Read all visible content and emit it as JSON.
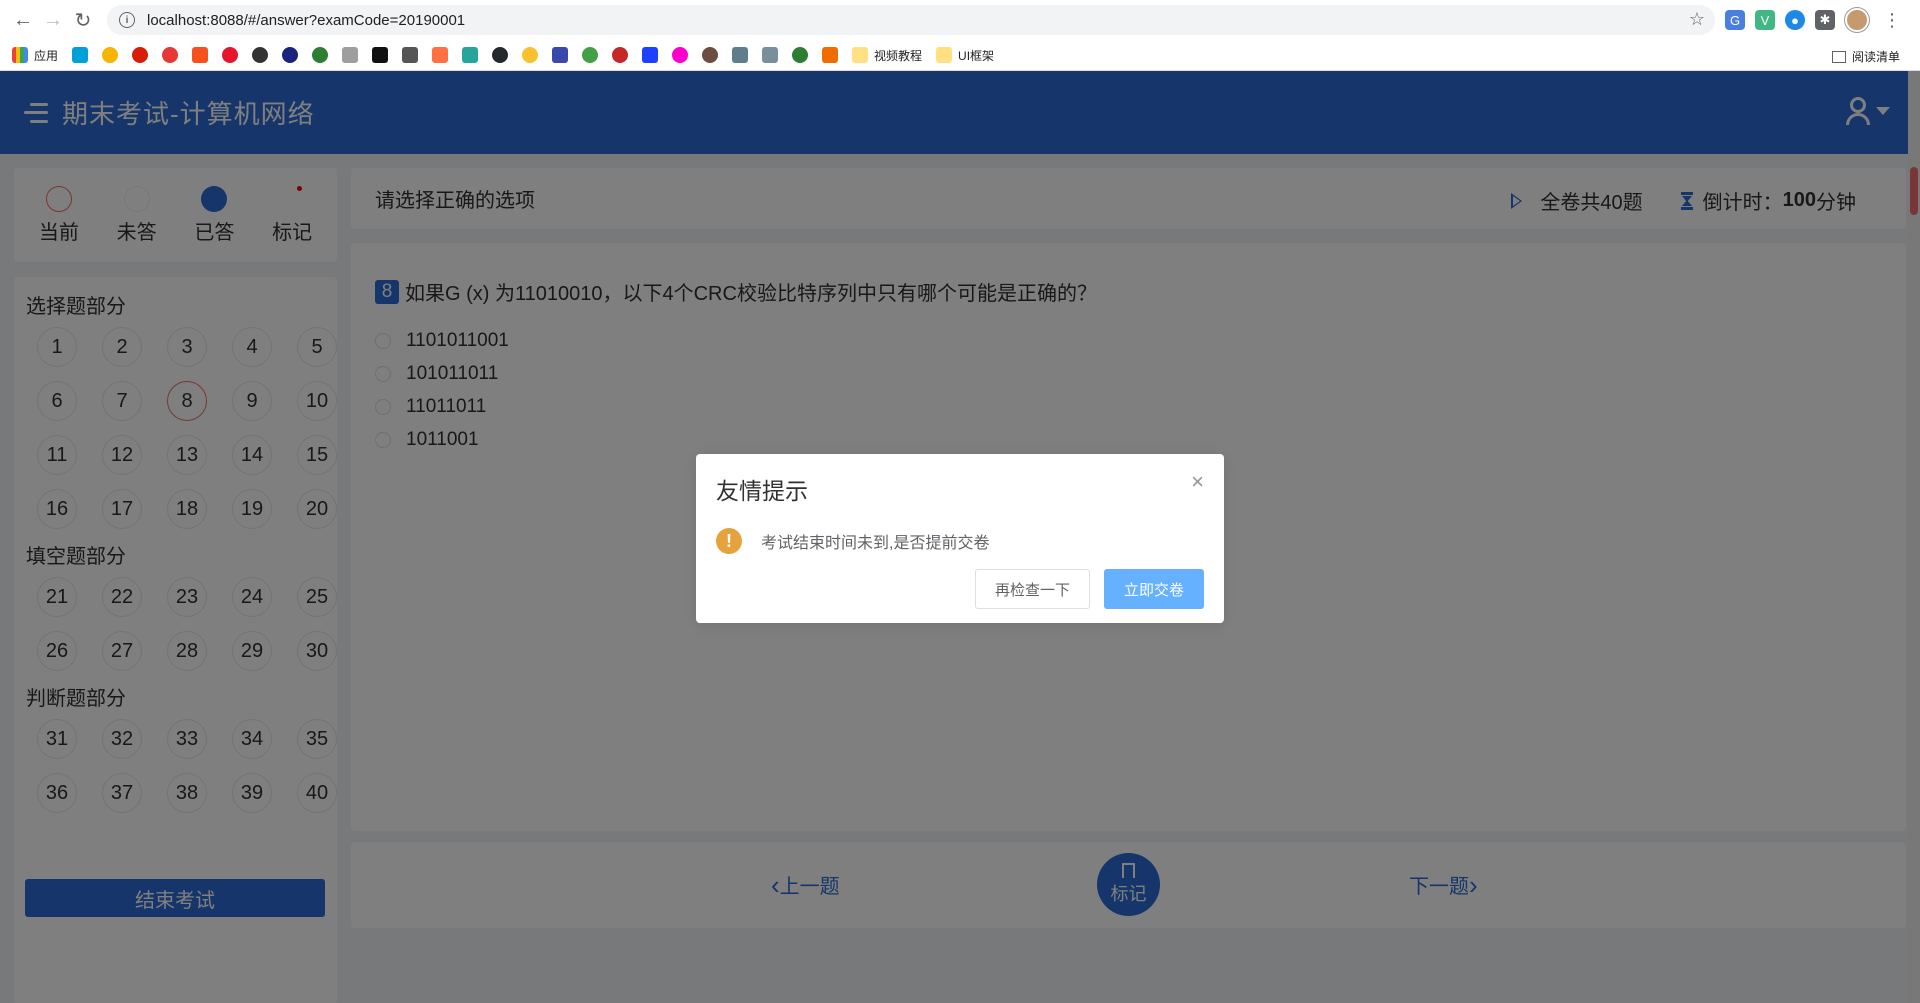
{
  "browser": {
    "url": "localhost:8088/#/answer?examCode=20190001",
    "bookmarks": {
      "apps": "应用",
      "video_tutorials": "视频教程",
      "ui_frameworks": "UI框架"
    },
    "reading_list": "阅读清单"
  },
  "header": {
    "title": "期末考试-计算机网络"
  },
  "legend": {
    "current": "当前",
    "unanswered": "未答",
    "answered": "已答",
    "marked": "标记"
  },
  "sections": [
    {
      "title": "选择题部分",
      "numbers": [
        "1",
        "2",
        "3",
        "4",
        "5",
        "6",
        "7",
        "8",
        "9",
        "10",
        "11",
        "12",
        "13",
        "14",
        "15",
        "16",
        "17",
        "18",
        "19",
        "20"
      ]
    },
    {
      "title": "填空题部分",
      "numbers": [
        "21",
        "22",
        "23",
        "24",
        "25",
        "26",
        "27",
        "28",
        "29",
        "30"
      ]
    },
    {
      "title": "判断题部分",
      "numbers": [
        "31",
        "32",
        "33",
        "34",
        "35",
        "36",
        "37",
        "38",
        "39",
        "40"
      ]
    }
  ],
  "current_question": 8,
  "end_exam_label": "结束考试",
  "question_header": {
    "title": "请选择正确的选项",
    "total": "全卷共40题",
    "countdown_label": "倒计时：",
    "countdown_value": "100",
    "countdown_unit": "分钟"
  },
  "question": {
    "number": "8",
    "stem": "如果G (x) 为11010010，以下4个CRC校验比特序列中只有哪个可能是正确的？",
    "options": [
      "1101011001",
      "101011011",
      "11011011",
      "1011001"
    ]
  },
  "footer": {
    "prev": "上一题",
    "mark": "标记",
    "next": "下一题"
  },
  "dialog": {
    "title": "友情提示",
    "message": "考试结束时间未到,是否提前交卷",
    "cancel": "再检查一下",
    "confirm": "立即交卷"
  },
  "colors": {
    "primary": "#2a6bd7",
    "current_ring": "#f56c6c",
    "warning": "#e6a23c",
    "confirm_button": "#66b1ff"
  }
}
